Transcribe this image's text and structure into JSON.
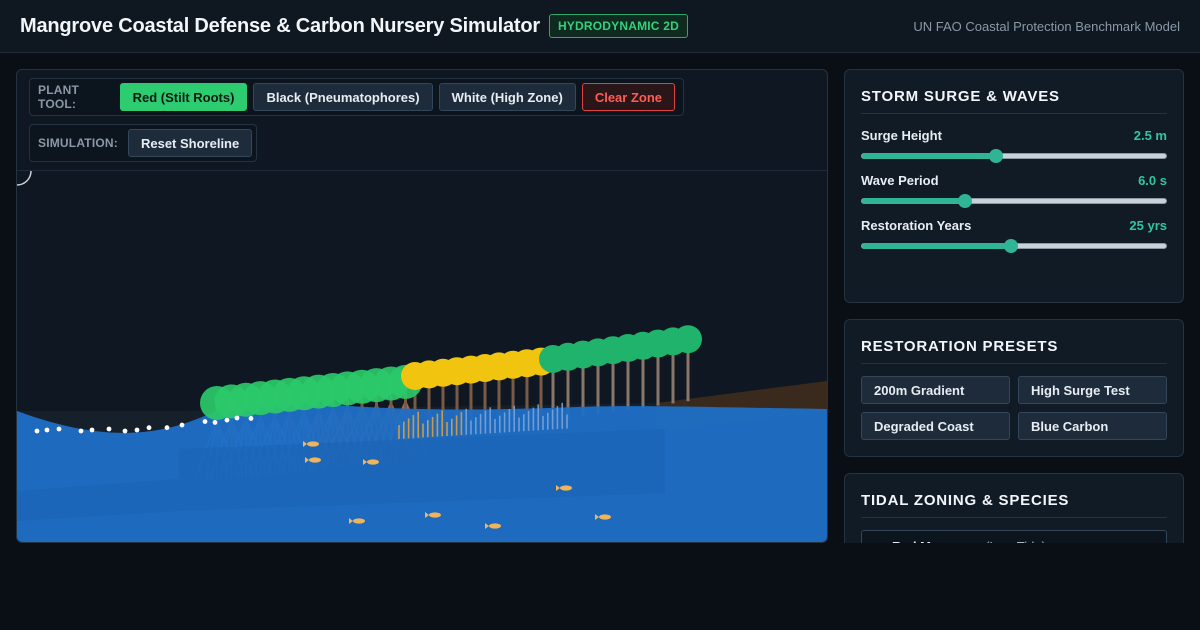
{
  "header": {
    "title": "Mangrove Coastal Defense & Carbon Nursery Simulator",
    "badge": "HYDRODYNAMIC 2D",
    "benchmark": "UN FAO Coastal Protection Benchmark Model"
  },
  "toolbar": {
    "plant_label": "PLANT TOOL:",
    "plant_tools": [
      "Red (Stilt Roots)",
      "Black (Pneumatophores)",
      "White (High Zone)"
    ],
    "active_tool": "Red (Stilt Roots)",
    "clear_label": "Clear Zone",
    "sim_label": "SIMULATION:",
    "reset_label": "Reset Shoreline"
  },
  "storm": {
    "title": "STORM SURGE & WAVES",
    "sliders": [
      {
        "label": "Surge Height",
        "value": "2.5 m",
        "fraction": 0.44
      },
      {
        "label": "Wave Period",
        "value": "6.0 s",
        "fraction": 0.34
      },
      {
        "label": "Restoration Years",
        "value": "25 yrs",
        "fraction": 0.49
      }
    ]
  },
  "presets": {
    "title": "RESTORATION PRESETS",
    "items": [
      "200m Gradient",
      "High Surge Test",
      "Degraded Coast",
      "Blue Carbon"
    ]
  },
  "zoning": {
    "title": "TIDAL ZONING & SPECIES",
    "first_species": "Red Mangrove",
    "first_zone": "(Low Tide)"
  },
  "colors": {
    "accent": "#2ecc71",
    "water": "#1f6fc4",
    "red_mangrove_canopy": "#2bc96a",
    "black_mangrove_canopy": "#f1c40f",
    "white_mangrove_canopy": "#1fb36b",
    "danger": "#e0433f"
  }
}
